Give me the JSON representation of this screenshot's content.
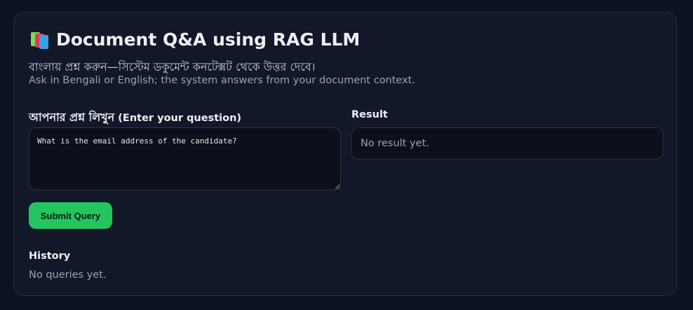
{
  "header": {
    "icon": "books-icon",
    "title": "Document Q&A using RAG LLM",
    "subtitle_bn": "বাংলায় প্রশ্ন করুন—সিস্টেম ডকুমেন্ট কনটেক্সট থেকে উত্তর দেবে।",
    "subtitle_en": "Ask in Bengali or English; the system answers from your document context."
  },
  "query": {
    "label_bn": "আপনার প্রশ্ন লিখুন",
    "label_en": "(Enter your question)",
    "value": "What is the email address of the candidate?",
    "submit_label": "Submit Query",
    "accent": "#22c55e"
  },
  "result": {
    "label": "Result",
    "text": "No result yet."
  },
  "history": {
    "label": "History",
    "empty_text": "No queries yet."
  }
}
